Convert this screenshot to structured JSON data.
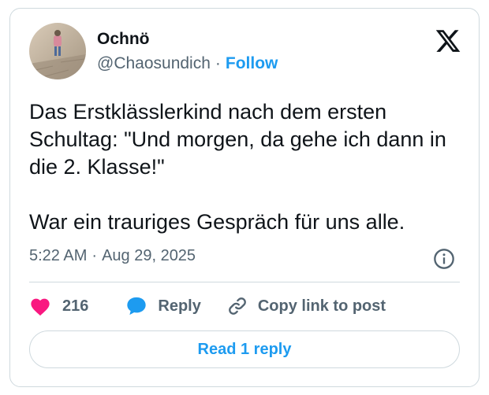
{
  "author": {
    "name": "Ochnö",
    "handle": "@Chaosundich",
    "separator": "·",
    "follow_label": "Follow",
    "avatar_icon": "user-avatar-photo"
  },
  "brand_icon": "x-logo-icon",
  "tweet": {
    "text": "Das Erstklässlerkind nach dem ersten Schultag: \"Und morgen, da gehe ich dann in die 2. Klasse!\"\n\nWar ein trauriges Gespräch für uns alle.",
    "time": "5:22 AM",
    "separator": "·",
    "date": "Aug 29, 2025"
  },
  "actions": {
    "like_count": "216",
    "reply_label": "Reply",
    "copy_label": "Copy link to post"
  },
  "read_replies_label": "Read 1 reply",
  "colors": {
    "accent": "#1d9bf0",
    "like": "#f91880",
    "text": "#0f1419",
    "muted": "#536471",
    "border": "#cfd9de"
  }
}
